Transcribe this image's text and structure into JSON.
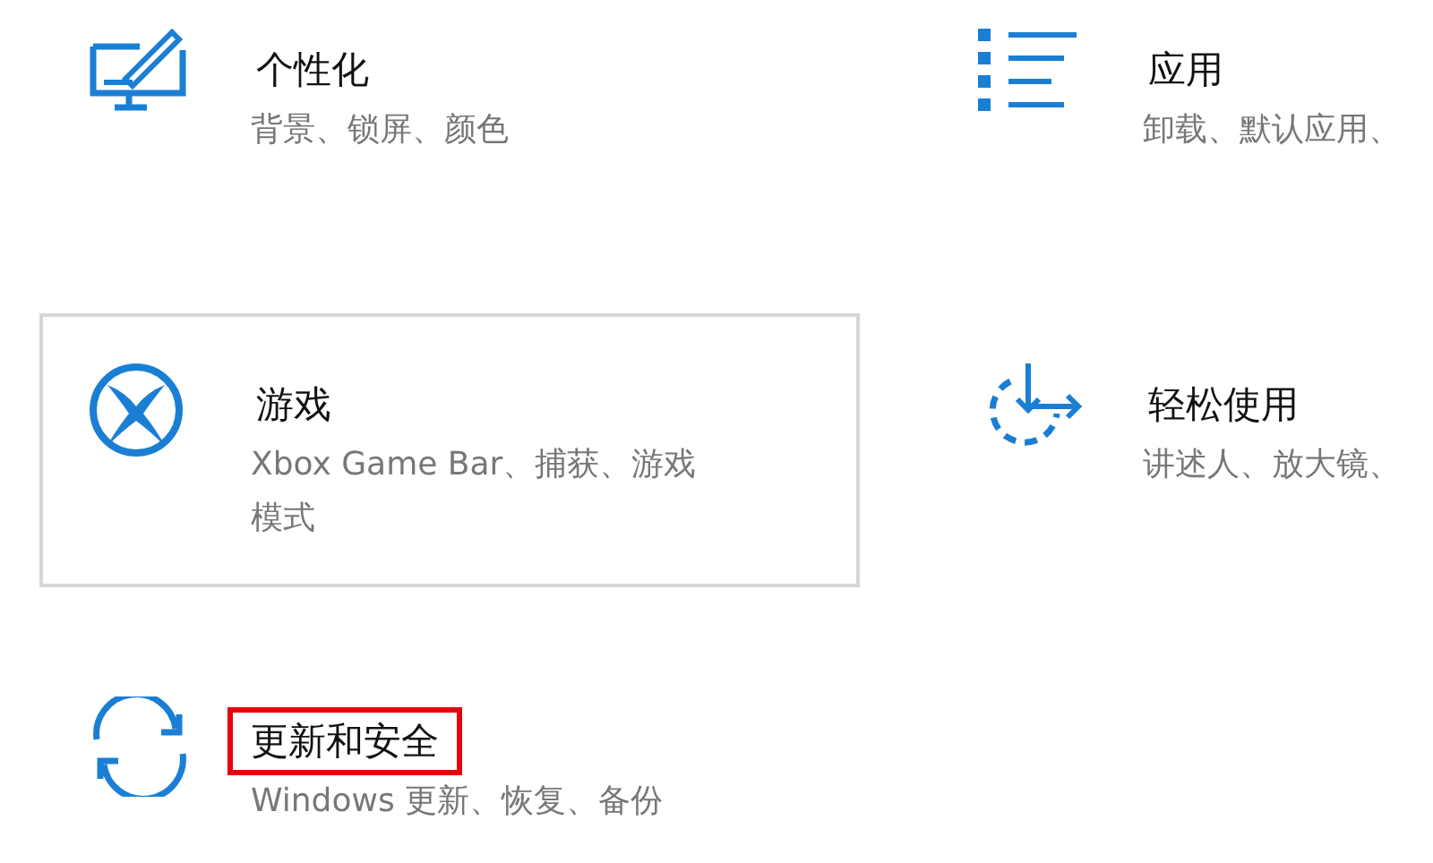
{
  "tiles": [
    {
      "title": "个性化",
      "subtitle": "背景、锁屏、颜色",
      "bordered": false,
      "title_marked": false
    },
    {
      "title": "应用",
      "subtitle": "卸载、默认应用、",
      "bordered": false,
      "title_marked": false
    },
    {
      "title": "游戏",
      "subtitle": "Xbox Game Bar、捕获、游戏模式",
      "bordered": true,
      "title_marked": false
    },
    {
      "title": "轻松使用",
      "subtitle": "讲述人、放大镜、",
      "bordered": false,
      "title_marked": false
    },
    {
      "title": "更新和安全",
      "subtitle": "Windows 更新、恢复、备份",
      "bordered": false,
      "title_marked": true
    }
  ]
}
